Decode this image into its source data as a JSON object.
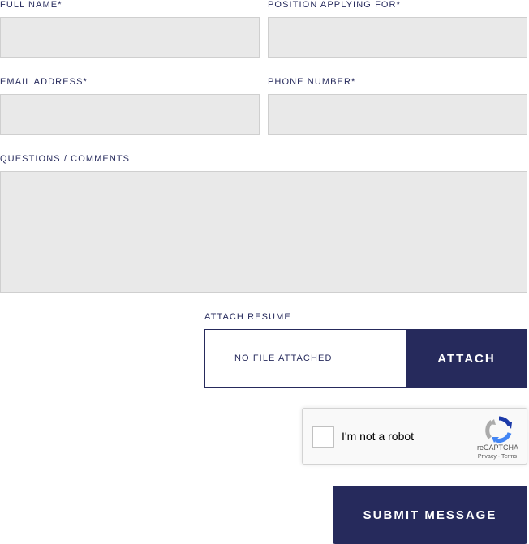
{
  "form": {
    "full_name": {
      "label": "FULL NAME*",
      "value": ""
    },
    "position": {
      "label": "POSITION APPLYING FOR*",
      "value": ""
    },
    "email": {
      "label": "EMAIL ADDRESS*",
      "value": ""
    },
    "phone": {
      "label": "PHONE NUMBER*",
      "value": ""
    },
    "comments": {
      "label": "QUESTIONS / COMMENTS",
      "value": ""
    }
  },
  "resume": {
    "label": "ATTACH RESUME",
    "status": "NO FILE ATTACHED",
    "button_label": "ATTACH"
  },
  "recaptcha": {
    "label": "I'm not a robot",
    "brand": "reCAPTCHA",
    "privacy": "Privacy",
    "separator": " - ",
    "terms": "Terms",
    "checked": false
  },
  "submit": {
    "label": "SUBMIT MESSAGE"
  },
  "colors": {
    "accent": "#262a5c",
    "field_bg": "#e9e9e9",
    "field_border": "#cfcfcf"
  }
}
